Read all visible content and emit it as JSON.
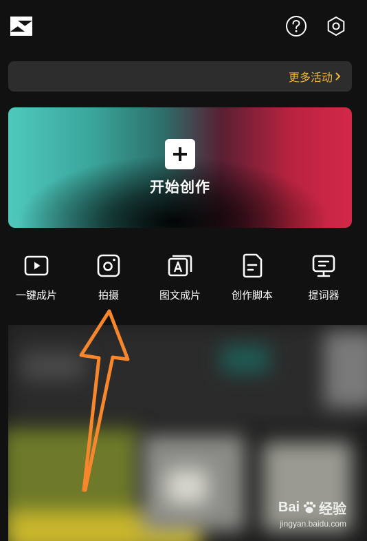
{
  "header": {
    "logo_icon": "capcut-logo-icon",
    "help_icon": "help-icon",
    "settings_icon": "settings-icon"
  },
  "activity": {
    "more_label": "更多活动"
  },
  "create": {
    "label": "开始创作",
    "icon": "plus-icon"
  },
  "tools": [
    {
      "label": "一键成片",
      "icon": "play-icon"
    },
    {
      "label": "拍摄",
      "icon": "camera-icon"
    },
    {
      "label": "图文成片",
      "icon": "text-image-icon"
    },
    {
      "label": "创作脚本",
      "icon": "script-icon"
    },
    {
      "label": "提词器",
      "icon": "teleprompter-icon"
    }
  ],
  "watermark": {
    "brand_left": "Bai",
    "brand_right": "经验",
    "url": "jingyan.baidu.com"
  },
  "colors": {
    "background": "#111111",
    "activity_bar": "#2d2d2d",
    "accent_gold": "#f0b53b",
    "arrow_orange": "#f7862c"
  }
}
